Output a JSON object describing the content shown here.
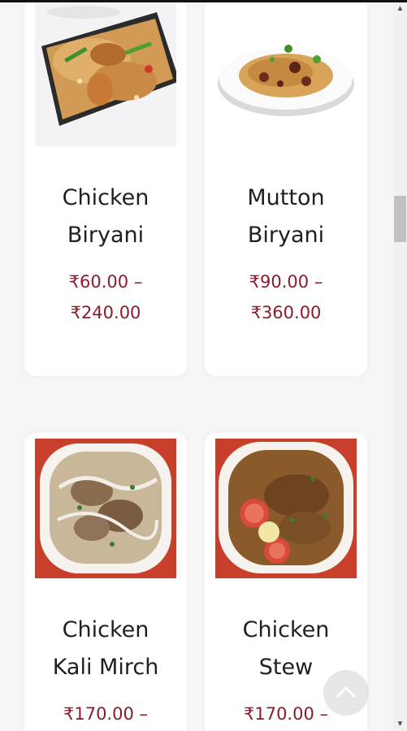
{
  "products": [
    {
      "name_line1": "Chicken",
      "name_line2": "Biryani",
      "price_line1": "₹60.00 –",
      "price_line2": "₹240.00",
      "image_icon": "chicken-biryani-photo"
    },
    {
      "name_line1": "Mutton",
      "name_line2": "Biryani",
      "price_line1": "₹90.00 –",
      "price_line2": "₹360.00",
      "image_icon": "mutton-biryani-photo"
    },
    {
      "name_line1": "Chicken",
      "name_line2": "Kali Mirch",
      "price_line1": "₹170.00 –",
      "price_line2": "",
      "image_icon": "chicken-kali-mirch-photo"
    },
    {
      "name_line1": "Chicken",
      "name_line2": "Stew",
      "price_line1": "₹170.00 –",
      "price_line2": "",
      "image_icon": "chicken-stew-photo"
    }
  ],
  "colors": {
    "price": "#8a1d2c",
    "name": "#1f1f1f",
    "card": "#ffffff",
    "curry_plate_bg": "#c8402b"
  },
  "icons": {
    "scroll_to_top": "chevron-up-icon",
    "scroll_up": "scroll-up-arrow-icon",
    "scroll_down": "scroll-down-arrow-icon"
  }
}
